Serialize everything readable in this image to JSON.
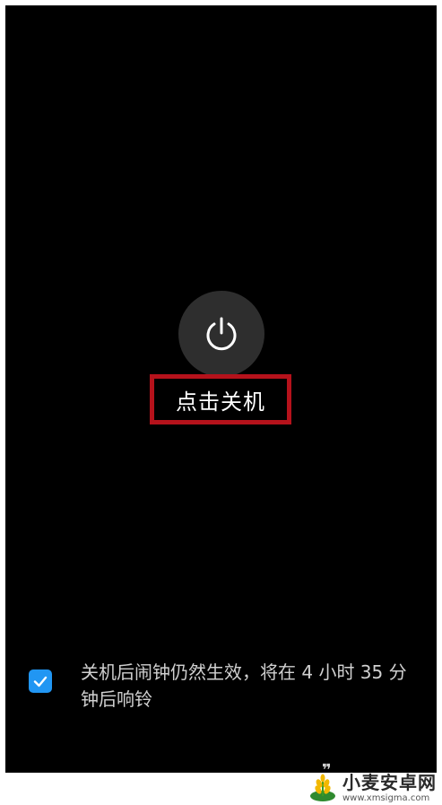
{
  "power_menu": {
    "power_icon": "power-icon",
    "power_label": "点击关机"
  },
  "alarm_notice": {
    "checked": true,
    "text": "关机后闹钟仍然生效，将在 4 小时 35 分钟后响铃"
  },
  "watermark": {
    "name": "小麦安卓网",
    "url": "www.xmsigma.com",
    "logo_icon": "wheat-logo-icon"
  },
  "colors": {
    "screen_background": "#000000",
    "power_button_background": "#2e2e2e",
    "highlight_border": "#b5121b",
    "checkbox": "#2196f3"
  }
}
